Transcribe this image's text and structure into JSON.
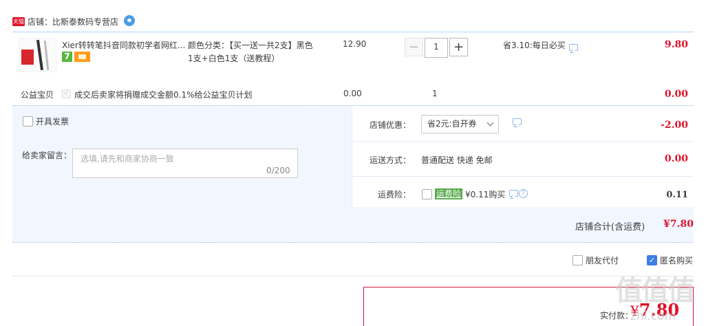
{
  "store": {
    "badge": "天猫",
    "label": "店铺：比斯泰数码专营店",
    "chat_icon": "wangwang-icon"
  },
  "item": {
    "title": "Xier转转笔抖音同款初学者网红...",
    "badge_7": "7",
    "spec": "颜色分类：【买一送一共2支】黑色1支+白色1支（送教程）",
    "unit_price": "12.90",
    "qty_minus": "−",
    "qty": "1",
    "qty_plus": "+",
    "promo": "省3.10:每日必买",
    "total": "9.80"
  },
  "charity": {
    "label": "公益宝贝",
    "text": "成交后卖家将捐赠成交金额0.1%给公益宝贝计划",
    "price": "0.00",
    "qty": "1",
    "total": "0.00"
  },
  "order": {
    "invoice_label": "开具发票",
    "message_label": "给卖家留言：",
    "message_placeholder": "选填,请先和商家协商一致",
    "message_count": "0/200",
    "coupon_label": "店铺优惠：",
    "coupon_value": "省2元:自开券",
    "coupon_total": "-2.00",
    "shipping_label": "运送方式：",
    "shipping_value": "普通配送 快递 免邮",
    "shipping_total": "0.00",
    "insurance_label": "运费险：",
    "insurance_tag": "运费险",
    "insurance_price": "¥0.11购买",
    "insurance_total": "0.11",
    "store_total_label": "店铺合计(含运费)",
    "store_total": "¥7.80"
  },
  "options": {
    "friend_pay": "朋友代付",
    "anonymous": "匿名购买",
    "anonymous_checked": true
  },
  "pay": {
    "label": "实付款：",
    "currency": "¥",
    "amount": "7.80"
  },
  "watermark": {
    "logo": "值值值",
    "text": "zhi.com"
  },
  "colors": {
    "price_red": "#e0122a",
    "panel_bg": "#f2f7ff",
    "checkbox_blue": "#3d7de4",
    "insurance_green": "#58a94c"
  }
}
